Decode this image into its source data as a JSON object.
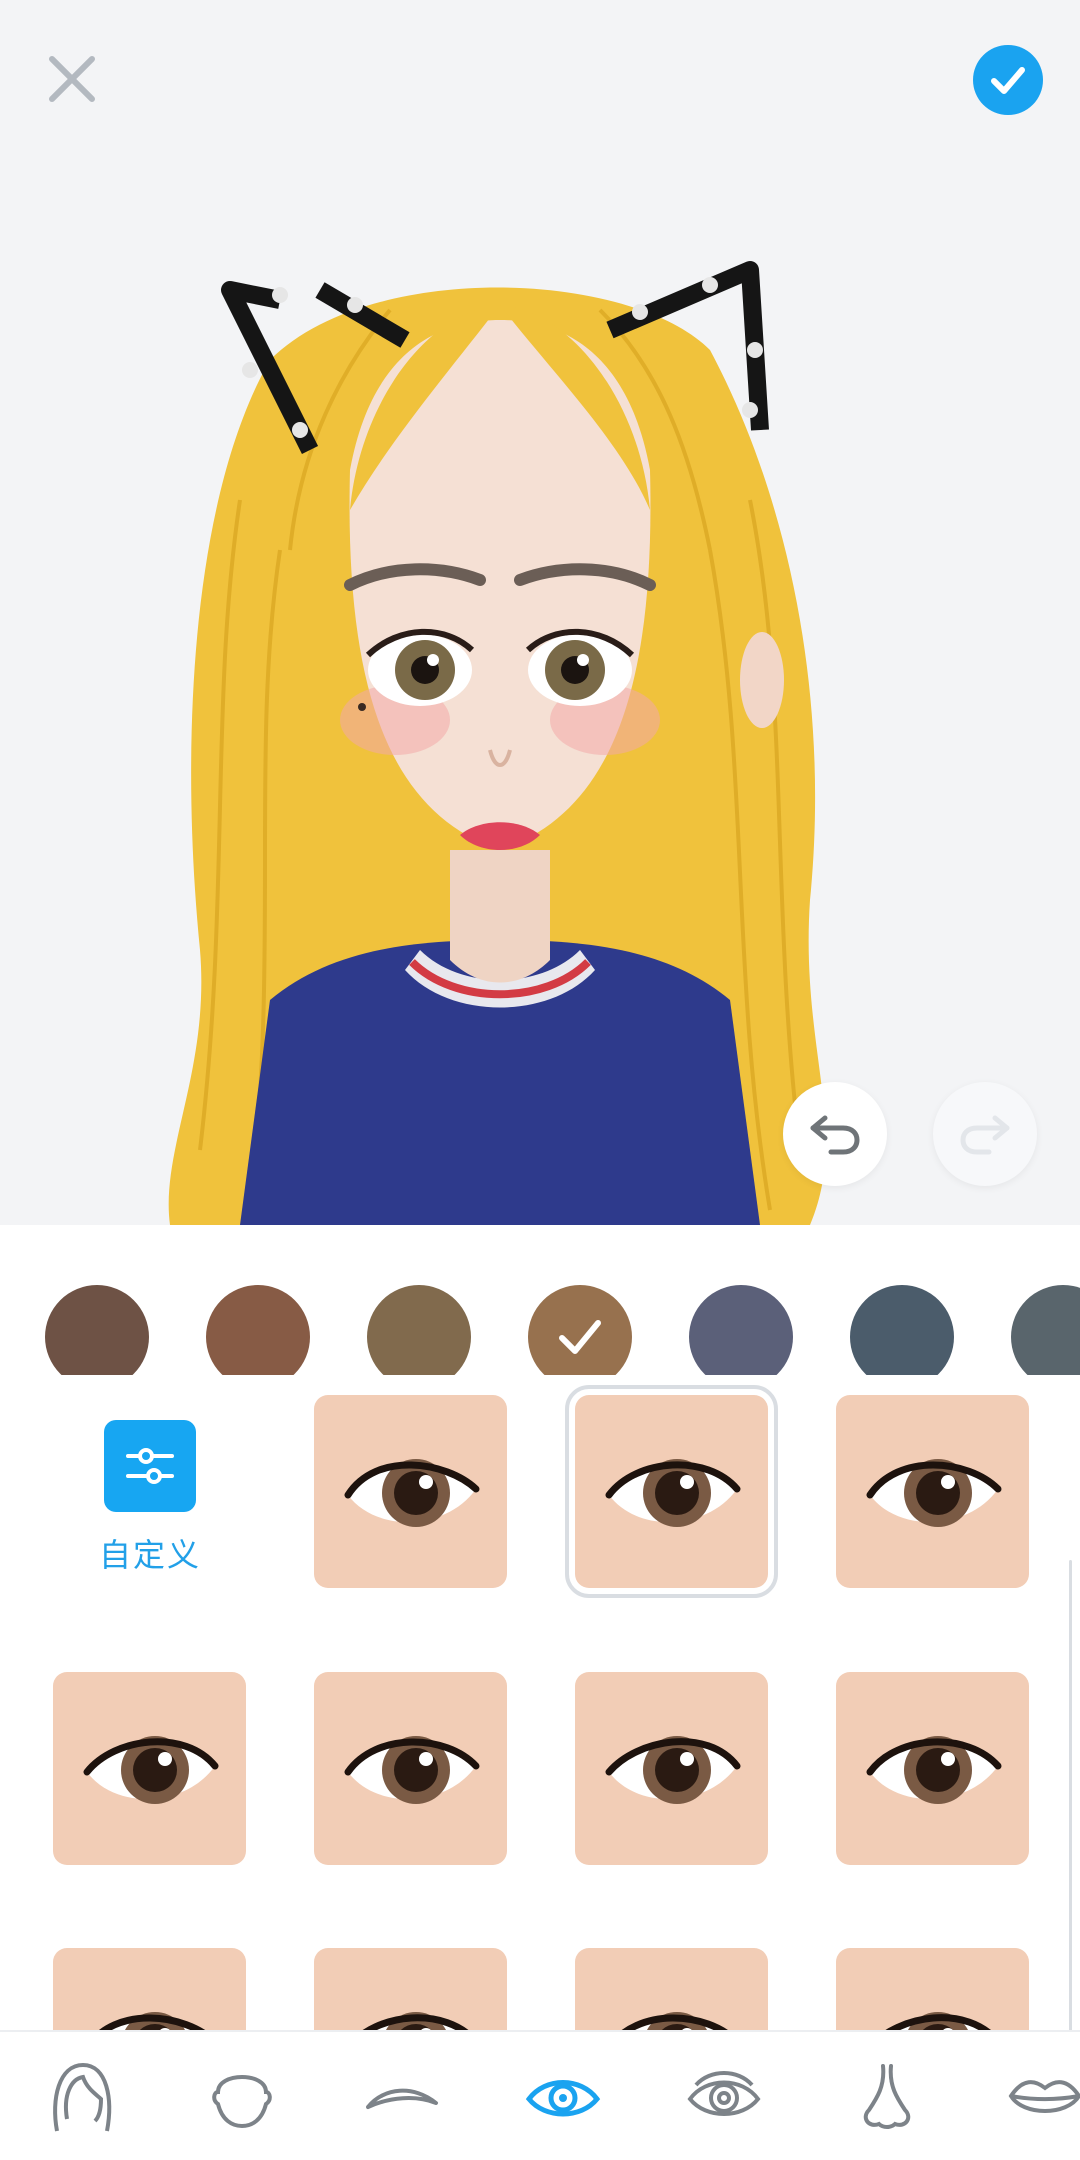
{
  "header": {
    "close_icon": "close-icon",
    "confirm_icon": "check-icon",
    "accent_color": "#1aa3f0"
  },
  "history": {
    "undo_icon": "undo-icon",
    "redo_icon": "redo-icon",
    "redo_enabled": false
  },
  "colors": {
    "swatches": [
      "#6e5245",
      "#875b45",
      "#816a4d",
      "#97714e",
      "#5b6079",
      "#4b5c6b",
      "#59656c"
    ],
    "selected_index": 3
  },
  "custom": {
    "label": "自定义",
    "icon": "sliders-icon"
  },
  "eye_styles": {
    "selected_index": 1,
    "count_visible": 11
  },
  "tabs": [
    {
      "name": "hair",
      "icon": "hair-icon"
    },
    {
      "name": "face",
      "icon": "face-icon"
    },
    {
      "name": "eyebrow",
      "icon": "eyebrow-icon"
    },
    {
      "name": "eye",
      "icon": "eye-icon",
      "active": true
    },
    {
      "name": "eye-detail",
      "icon": "eye-detail-icon"
    },
    {
      "name": "nose",
      "icon": "nose-icon"
    },
    {
      "name": "lips",
      "icon": "lips-icon"
    }
  ]
}
